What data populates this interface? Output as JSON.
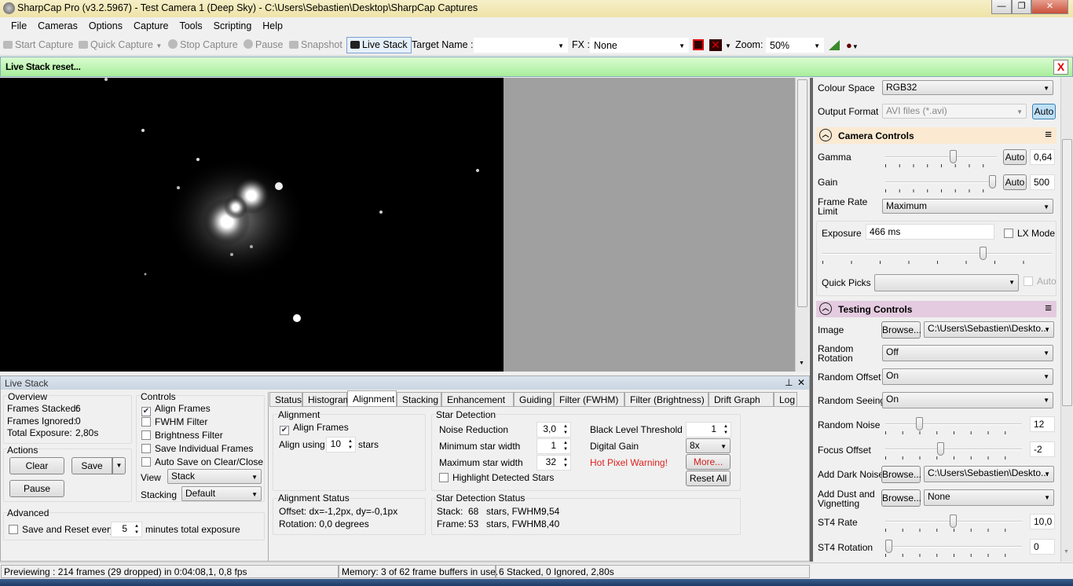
{
  "window": {
    "title": "SharpCap Pro (v3.2.5967) - Test Camera 1 (Deep Sky) - C:\\Users\\Sebastien\\Desktop\\SharpCap Captures",
    "minimize": "—",
    "maximize": "❐",
    "close": "✕"
  },
  "menu": [
    "File",
    "Cameras",
    "Options",
    "Capture",
    "Tools",
    "Scripting",
    "Help"
  ],
  "toolbar": {
    "start_capture": "Start Capture",
    "quick_capture": "Quick Capture",
    "stop_capture": "Stop Capture",
    "pause": "Pause",
    "snapshot": "Snapshot",
    "live_stack": "Live Stack",
    "target_name_label": "Target Name :",
    "target_name_value": "",
    "fx_label": "FX :",
    "fx_value": "None",
    "zoom_label": "Zoom:",
    "zoom_value": "50%"
  },
  "notification": {
    "text": "Live Stack reset...",
    "close": "X"
  },
  "live_stack": {
    "title": "Live Stack",
    "pin": "⊥",
    "close": "✕",
    "overview": {
      "title": "Overview",
      "frames_stacked_label": "Frames Stacked:",
      "frames_stacked": "6",
      "frames_ignored_label": "Frames Ignored:",
      "frames_ignored": "0",
      "total_exposure_label": "Total Exposure:",
      "total_exposure": "2,80s"
    },
    "actions": {
      "title": "Actions",
      "clear": "Clear",
      "save": "Save",
      "pause": "Pause"
    },
    "controls": {
      "title": "Controls",
      "align_frames": "Align Frames",
      "align_frames_checked": true,
      "fwhm_filter": "FWHM Filter",
      "brightness_filter": "Brightness Filter",
      "save_individual": "Save Individual Frames",
      "auto_save": "Auto Save on Clear/Close",
      "view_label": "View",
      "view_value": "Stack",
      "stacking_label": "Stacking",
      "stacking_value": "Default"
    },
    "advanced": {
      "title": "Advanced",
      "save_reset_label": "Save and Reset every",
      "save_reset_value": "5",
      "save_reset_suffix": "minutes total exposure"
    },
    "tabs": [
      "Status",
      "Histogram",
      "Alignment",
      "Stacking",
      "Enhancement",
      "Guiding",
      "Filter (FWHM)",
      "Filter (Brightness)",
      "Drift Graph",
      "Log"
    ],
    "active_tab": "Alignment",
    "alignment": {
      "title": "Alignment",
      "align_frames": "Align Frames",
      "align_using_label": "Align using",
      "align_using_value": "10",
      "stars": "stars"
    },
    "star_detection": {
      "title": "Star Detection",
      "noise_reduction_label": "Noise Reduction",
      "noise_reduction": "3,0",
      "min_width_label": "Minimum star width",
      "min_width": "1",
      "max_width_label": "Maximum star width",
      "max_width": "32",
      "highlight": "Highlight Detected Stars",
      "black_level_label": "Black Level Threshold",
      "black_level": "1",
      "digital_gain_label": "Digital Gain",
      "digital_gain": "8x",
      "hot_pixel_warning": "Hot Pixel Warning!",
      "more": "More...",
      "reset_all": "Reset All"
    },
    "alignment_status": {
      "title": "Alignment Status",
      "offset": "Offset: dx=-1,2px, dy=-0,1px",
      "rotation": "Rotation: 0,0 degrees"
    },
    "star_detection_status": {
      "title": "Star Detection Status",
      "stack_label": "Stack:",
      "stack_stars": "68",
      "stack_fwhm_label": "stars, FWHM:",
      "stack_fwhm": "9,54",
      "frame_label": "Frame:",
      "frame_stars": "53",
      "frame_fwhm_label": "stars, FWHM:",
      "frame_fwhm": "8,40"
    }
  },
  "right_panel": {
    "colour_space_label": "Colour Space",
    "colour_space": "RGB32",
    "output_format_label": "Output Format",
    "output_format": "AVI files (*.avi)",
    "output_auto": "Auto",
    "camera_controls": {
      "title": "Camera Controls",
      "color": "#fbe9d2",
      "gamma_label": "Gamma",
      "gamma_auto": "Auto",
      "gamma": "0,64",
      "gamma_pct": 62,
      "gain_label": "Gain",
      "gain_auto": "Auto",
      "gain": "500",
      "gain_pct": 100,
      "frame_rate_label": "Frame Rate Limit",
      "frame_rate": "Maximum",
      "exposure_label": "Exposure",
      "exposure": "466 ms",
      "lx_mode": "LX Mode",
      "exposure_pct": 71,
      "quick_picks_label": "Quick Picks",
      "quick_picks": "",
      "quick_auto": "Auto"
    },
    "testing_controls": {
      "title": "Testing Controls",
      "color": "#e4cbe0",
      "image_label": "Image",
      "browse": "Browse...",
      "image_value": "C:\\Users\\Sebastien\\Deskto...",
      "random_rotation_label": "Random Rotation",
      "random_rotation": "Off",
      "random_offset_label": "Random Offset",
      "random_offset": "On",
      "random_seeing_label": "Random Seeing",
      "random_seeing": "On",
      "random_noise_label": "Random Noise",
      "random_noise": "12",
      "random_noise_pct": 24,
      "focus_offset_label": "Focus Offset",
      "focus_offset": "-2",
      "focus_offset_pct": 40,
      "dark_noise_label": "Add Dark Noise",
      "dark_noise_value": "C:\\Users\\Sebastien\\Deskto...",
      "dust_label": "Add Dust and Vignetting",
      "dust_value": "None",
      "st4_rate_label": "ST4 Rate",
      "st4_rate": "10,0",
      "st4_rate_pct": 50,
      "st4_rotation_label": "ST4 Rotation",
      "st4_rotation": "0",
      "st4_rotation_pct": 0
    }
  },
  "status": {
    "previewing": "Previewing : 214 frames (29 dropped) in 0:04:08,1, 0,8 fps",
    "memory": "Memory: 3 of 62 frame buffers in use.",
    "stacked": "6 Stacked, 0 Ignored, 2,80s"
  }
}
